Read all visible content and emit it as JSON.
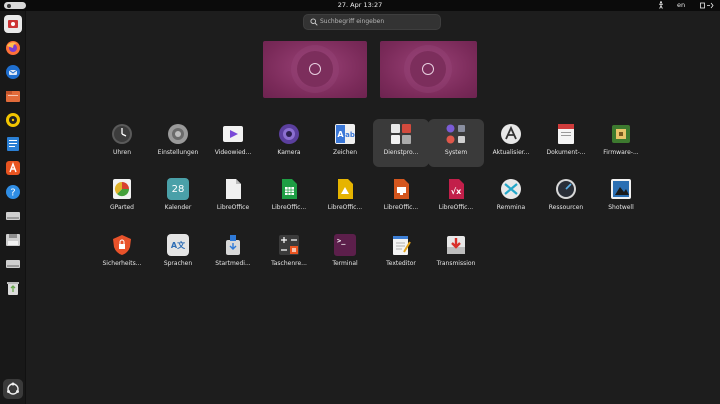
{
  "topbar": {
    "date_time": "27. Apr  13:27",
    "lang": "en"
  },
  "search": {
    "placeholder": "Suchbegriff eingeben"
  },
  "dock": [
    {
      "name": "dock-item-anmeldung",
      "color": "#e1e1e1"
    },
    {
      "name": "dock-item-firefox",
      "color": "#ff7139"
    },
    {
      "name": "dock-item-thunderbird",
      "color": "#1f6fd0"
    },
    {
      "name": "dock-item-files",
      "color": "#e16b3a"
    },
    {
      "name": "dock-item-rhythmbox",
      "color": "#f2c500"
    },
    {
      "name": "dock-item-writer",
      "color": "#2a7fd4"
    },
    {
      "name": "dock-item-app-center",
      "color": "#e95420"
    },
    {
      "name": "dock-item-help",
      "color": "#2f8de4"
    },
    {
      "name": "dock-item-drive1",
      "color": "#d0d0d0"
    },
    {
      "name": "dock-item-drive2",
      "color": "#d0d0d0"
    },
    {
      "name": "dock-item-drive3",
      "color": "#d0d0d0"
    },
    {
      "name": "dock-item-trash",
      "color": "#6aa84f"
    },
    {
      "name": "dock-item-show-apps",
      "color": "#e8e8e8"
    }
  ],
  "apps": {
    "row1": [
      {
        "label": "Uhren"
      },
      {
        "label": "Einstellungen"
      },
      {
        "label": "Videowied..."
      },
      {
        "label": "Kamera"
      },
      {
        "label": "Zeichen"
      },
      {
        "label": "Dienstpro..."
      },
      {
        "label": "System"
      },
      {
        "label": "Aktualisier..."
      },
      {
        "label": "Dokument-..."
      },
      {
        "label": "Firmware-..."
      }
    ],
    "row2": [
      {
        "label": "GParted"
      },
      {
        "label": "Kalender"
      },
      {
        "label": "LibreOffice"
      },
      {
        "label": "LibreOffic..."
      },
      {
        "label": "LibreOffic..."
      },
      {
        "label": "LibreOffic..."
      },
      {
        "label": "LibreOffic..."
      },
      {
        "label": "Remmina"
      },
      {
        "label": "Ressourcen"
      },
      {
        "label": "Shotwell"
      }
    ],
    "row3": [
      {
        "label": "Sicherheits..."
      },
      {
        "label": "Sprachen"
      },
      {
        "label": "Startmedi..."
      },
      {
        "label": "Taschenre..."
      },
      {
        "label": "Terminal"
      },
      {
        "label": "Texteditor"
      },
      {
        "label": "Transmission"
      }
    ]
  },
  "icons": {
    "kalender_day": "28",
    "terminal_prompt": ">_",
    "sprachen_glyph": "A文"
  }
}
